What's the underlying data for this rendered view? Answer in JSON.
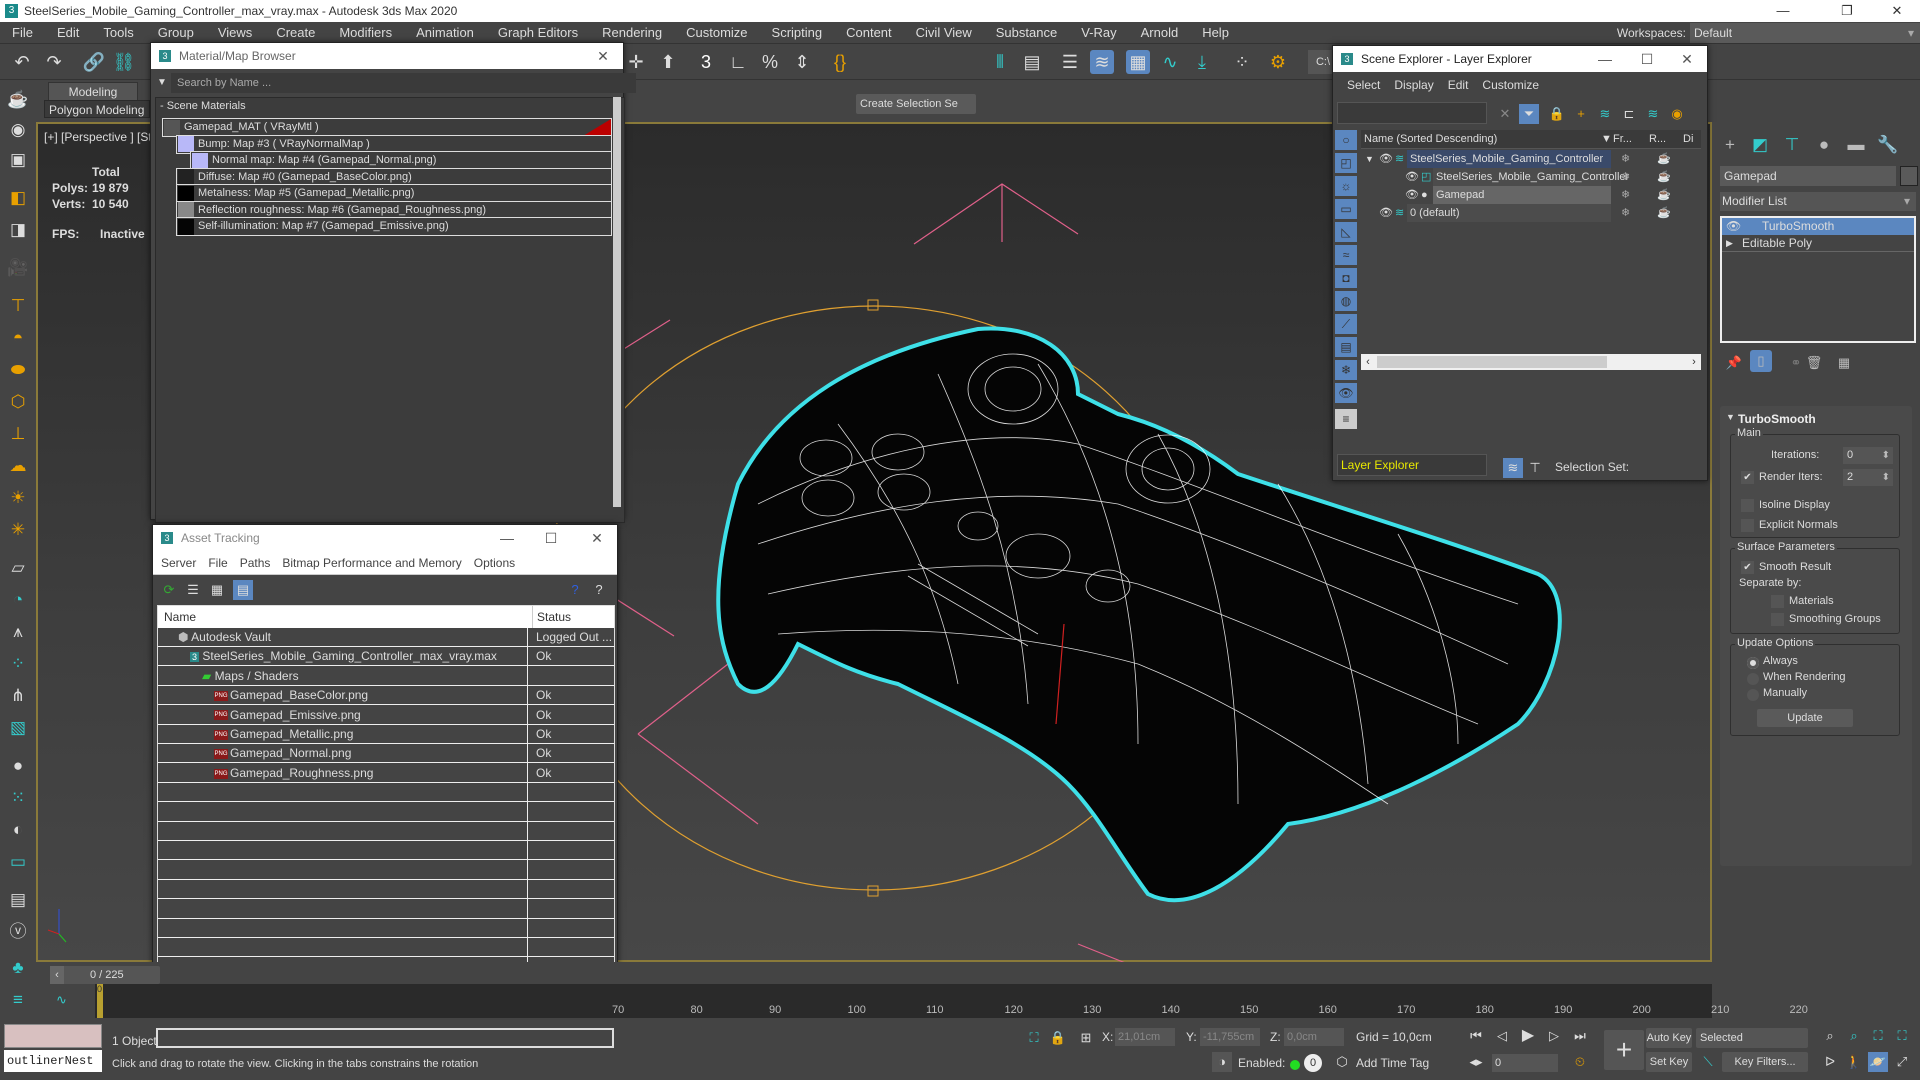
{
  "app": {
    "title": "SteelSeries_Mobile_Gaming_Controller_max_vray.max - Autodesk 3ds Max 2020",
    "logo": "3",
    "window_buttons": {
      "minimize": "—",
      "maximize": "❐",
      "close": "✕"
    }
  },
  "menu": [
    "File",
    "Edit",
    "Tools",
    "Group",
    "Views",
    "Create",
    "Modifiers",
    "Animation",
    "Graph Editors",
    "Rendering",
    "Customize",
    "Scripting",
    "Content",
    "Civil View",
    "Substance",
    "V-Ray",
    "Arnold",
    "Help"
  ],
  "workspaces": {
    "label": "Workspaces:",
    "value": "Default"
  },
  "toolbar": {
    "selection_set": "Create Selection Se",
    "path_field": "C:\\"
  },
  "ribbon": {
    "tab": "Modeling",
    "sub": "Polygon Modeling"
  },
  "viewport": {
    "label": "[+] [Perspective ] [St",
    "stats": {
      "header": "Total",
      "polys_label": "Polys:",
      "polys": "19 879",
      "verts_label": "Verts:",
      "verts": "10 540",
      "fps_label": "FPS:",
      "fps": "Inactive"
    },
    "selection_color": "#3ee0e8"
  },
  "material_browser": {
    "title": "Material/Map Browser",
    "search_placeholder": "Search by Name ...",
    "section": "- Scene Materials",
    "nodes": [
      {
        "label": "Gamepad_MAT  ( VRayMtl )",
        "swatch": "#555555",
        "level": 0
      },
      {
        "label": "Bump: Map #3  ( VRayNormalMap )",
        "swatch": "#b8b8f8",
        "level": 1
      },
      {
        "label": "Normal map: Map #4 (Gamepad_Normal.png)",
        "swatch": "#b8b8f8",
        "level": 2
      },
      {
        "label": "Diffuse: Map #0 (Gamepad_BaseColor.png)",
        "swatch": "#222222",
        "level": 1
      },
      {
        "label": "Metalness: Map #5 (Gamepad_Metallic.png)",
        "swatch": "#000000",
        "level": 1
      },
      {
        "label": "Reflection roughness: Map #6 (Gamepad_Roughness.png)",
        "swatch": "#888888",
        "level": 1
      },
      {
        "label": "Self-illumination: Map #7 (Gamepad_Emissive.png)",
        "swatch": "#050505",
        "level": 1
      }
    ]
  },
  "scene_explorer": {
    "title": "Scene Explorer - Layer Explorer",
    "menu": [
      "Select",
      "Display",
      "Edit",
      "Customize"
    ],
    "columns": {
      "name": "Name (Sorted Descending)",
      "frozen": "Fr...",
      "render": "R...",
      "display": "Di"
    },
    "rows": [
      {
        "name": "SteelSeries_Mobile_Gaming_Controller",
        "level": 0,
        "type": "layer",
        "selected": true
      },
      {
        "name": "SteelSeries_Mobile_Gaming_Controller",
        "level": 1,
        "type": "group",
        "selected": false
      },
      {
        "name": "Gamepad",
        "level": 1,
        "type": "object",
        "selected": false
      },
      {
        "name": "0 (default)",
        "level": 0,
        "type": "layer-default",
        "selected": false
      }
    ],
    "footer_mode": "Layer Explorer",
    "selection_set_label": "Selection Set:"
  },
  "command_panel": {
    "object_name": "Gamepad",
    "modifier_list": "Modifier List",
    "stack": [
      "TurboSmooth",
      "Editable Poly"
    ],
    "turbosmooth": {
      "title": "TurboSmooth",
      "main_label": "Main",
      "iterations_label": "Iterations:",
      "iterations": "0",
      "render_iters_label": "Render Iters:",
      "render_iters": "2",
      "render_iters_checked": true,
      "isoline_label": "Isoline Display",
      "isoline_checked": false,
      "explicit_label": "Explicit Normals",
      "explicit_checked": false,
      "surface_label": "Surface Parameters",
      "smooth_result_label": "Smooth Result",
      "smooth_result_checked": true,
      "separate_by_label": "Separate by:",
      "materials_label": "Materials",
      "materials_checked": false,
      "smoothing_groups_label": "Smoothing Groups",
      "smoothing_groups_checked": false,
      "update_label": "Update Options",
      "always_label": "Always",
      "when_rendering_label": "When Rendering",
      "manually_label": "Manually",
      "update_mode": "Always",
      "update_button": "Update"
    }
  },
  "asset_tracking": {
    "title": "Asset Tracking",
    "menu": [
      "Server",
      "File",
      "Paths",
      "Bitmap Performance and Memory",
      "Options"
    ],
    "columns": {
      "name": "Name",
      "status": "Status"
    },
    "rows": [
      {
        "name": "Autodesk Vault",
        "status": "Logged Out ...",
        "level": 1,
        "icon": "vault"
      },
      {
        "name": "SteelSeries_Mobile_Gaming_Controller_max_vray.max",
        "status": "Ok",
        "level": 2,
        "icon": "max"
      },
      {
        "name": "Maps / Shaders",
        "status": "",
        "level": 3,
        "icon": "maps"
      },
      {
        "name": "Gamepad_BaseColor.png",
        "status": "Ok",
        "level": 4,
        "icon": "png"
      },
      {
        "name": "Gamepad_Emissive.png",
        "status": "Ok",
        "level": 4,
        "icon": "png"
      },
      {
        "name": "Gamepad_Metallic.png",
        "status": "Ok",
        "level": 4,
        "icon": "png"
      },
      {
        "name": "Gamepad_Normal.png",
        "status": "Ok",
        "level": 4,
        "icon": "png"
      },
      {
        "name": "Gamepad_Roughness.png",
        "status": "Ok",
        "level": 4,
        "icon": "png"
      }
    ],
    "png_badge": "PNG"
  },
  "timeline": {
    "frame_display": "0 / 225",
    "current_frame": "0",
    "ticks": [
      "70",
      "80",
      "90",
      "100",
      "110",
      "120",
      "130",
      "140",
      "150",
      "160",
      "170",
      "180",
      "190",
      "200",
      "210",
      "220"
    ]
  },
  "status": {
    "maxscript": "outlinerNest",
    "selection": "1 Object",
    "prompt": "Click and drag to rotate the view.  Clicking in the tabs constrains the rotation",
    "x_label": "X:",
    "x": "21,01cm",
    "y_label": "Y:",
    "y": "-11,755cm",
    "z_label": "Z:",
    "z": "0,0cm",
    "grid": "Grid = 10,0cm",
    "enabled_label": "Enabled:",
    "enabled_count": "0",
    "add_time_tag": "Add Time Tag",
    "frame_field": "0",
    "auto_key": "Auto Key",
    "set_key": "Set Key",
    "key_mode": "Selected",
    "key_filters": "Key Filters..."
  }
}
